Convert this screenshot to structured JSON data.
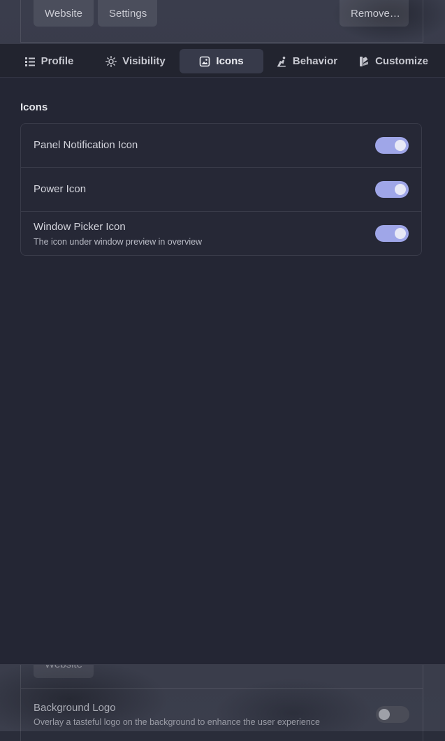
{
  "background": {
    "buttons": {
      "website": "Website",
      "settings": "Settings",
      "remove": "Remove…"
    },
    "bottom": {
      "website_button": "Website",
      "row_title": "Background Logo",
      "row_subtitle": "Overlay a tasteful logo on the background to enhance the user experience",
      "toggle_on": false
    }
  },
  "tabs": [
    {
      "label": "Profile",
      "icon": "list-icon",
      "active": false
    },
    {
      "label": "Visibility",
      "icon": "sun-icon",
      "active": false
    },
    {
      "label": "Icons",
      "icon": "image-icon",
      "active": true
    },
    {
      "label": "Behavior",
      "icon": "behavior-icon",
      "active": false
    },
    {
      "label": "Customize",
      "icon": "customize-icon",
      "active": false
    }
  ],
  "icons_section": {
    "title": "Icons",
    "rows": [
      {
        "title": "Panel Notification Icon",
        "subtitle": "",
        "enabled": true
      },
      {
        "title": "Power Icon",
        "subtitle": "",
        "enabled": true
      },
      {
        "title": "Window Picker Icon",
        "subtitle": "The icon under window preview in overview",
        "enabled": true
      }
    ]
  },
  "colors": {
    "accent": "#9fa6e8",
    "window_bg": "#242634"
  }
}
